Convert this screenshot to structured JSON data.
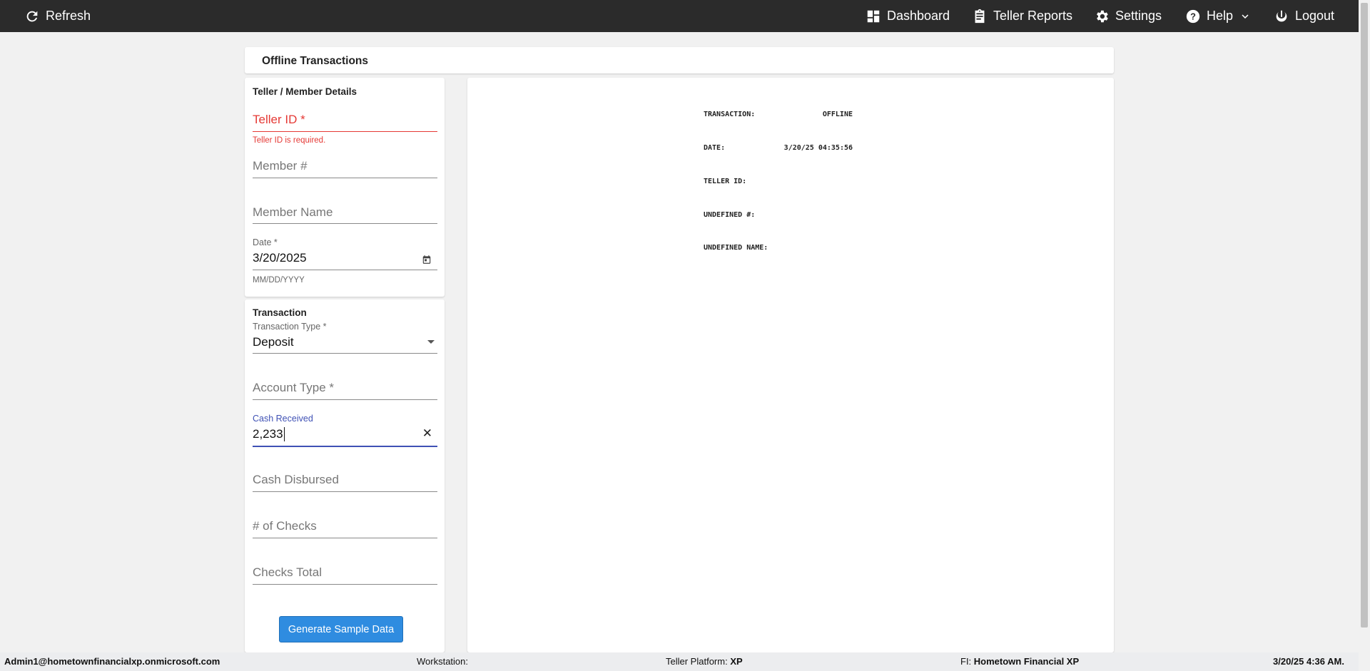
{
  "topbar": {
    "refresh": "Refresh",
    "dashboard": "Dashboard",
    "teller_reports": "Teller Reports",
    "settings": "Settings",
    "help": "Help",
    "logout": "Logout"
  },
  "page_title": "Offline Transactions",
  "details": {
    "heading": "Teller / Member Details",
    "teller_id": "Teller ID *",
    "teller_error": "Teller ID is required.",
    "member_no": "Member #",
    "member_name": "Member Name",
    "date_label": "Date *",
    "date_value": "3/20/2025",
    "date_hint": "MM/DD/YYYY"
  },
  "transaction": {
    "heading": "Transaction",
    "type_label": "Transaction Type *",
    "type_value": "Deposit",
    "account_type": "Account Type *",
    "cash_received_label": "Cash Received",
    "cash_received_value": "2,233",
    "cash_disbursed": "Cash Disbursed",
    "num_checks": "# of Checks",
    "checks_total": "Checks Total",
    "generate_button": "Generate Sample Data"
  },
  "receipt": {
    "lines": [
      {
        "label": "TRANSACTION:",
        "value": "OFFLINE"
      },
      {
        "label": "DATE:",
        "value": "3/20/25 04:35:56"
      },
      {
        "label": "TELLER ID:",
        "value": ""
      },
      {
        "label": "UNDEFINED #:",
        "value": ""
      },
      {
        "label": "UNDEFINED NAME:",
        "value": ""
      }
    ]
  },
  "footer": {
    "user": "Admin1@hometownfinancialxp.onmicrosoft.com",
    "workstation_label": "Workstation:",
    "platform_label": "Teller Platform: ",
    "platform_value": "XP",
    "fi_label": "FI: ",
    "fi_value": "Hometown Financial XP",
    "datetime": "3/20/25 4:36 AM."
  },
  "colors": {
    "error": "#e53935",
    "focus": "#3f51b5",
    "button": "#2f8ce0",
    "topbar": "#2b2b2b"
  }
}
